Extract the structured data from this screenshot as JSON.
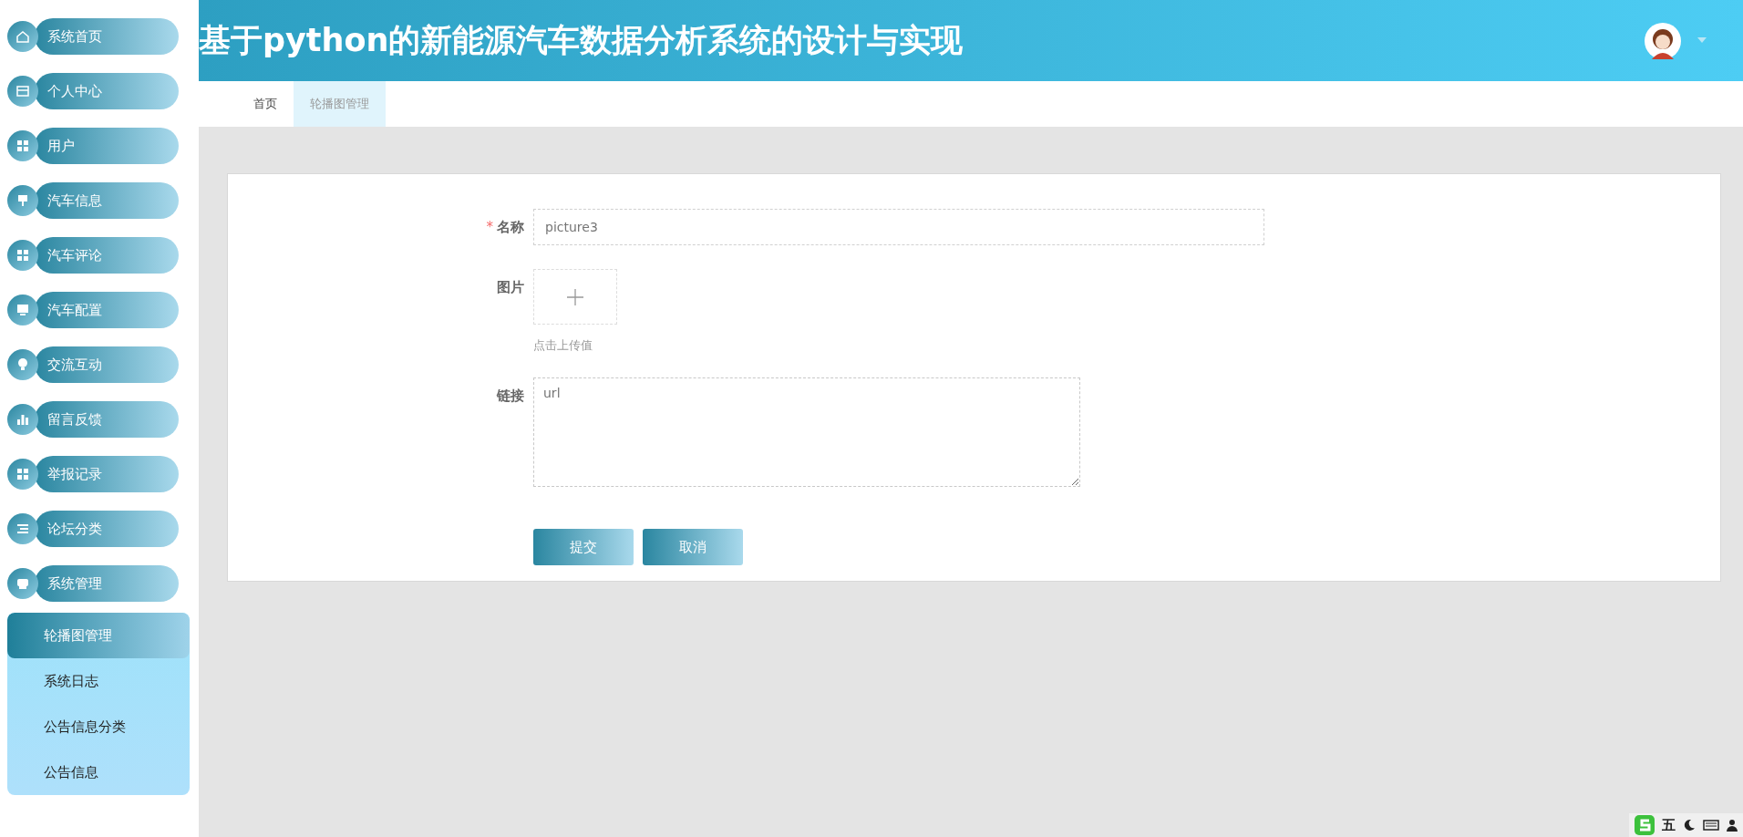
{
  "header": {
    "title": "基于python的新能源汽车数据分析系统的设计与实现"
  },
  "sidebar": {
    "items": [
      {
        "label": "系统首页"
      },
      {
        "label": "个人中心"
      },
      {
        "label": "用户"
      },
      {
        "label": "汽车信息"
      },
      {
        "label": "汽车评论"
      },
      {
        "label": "汽车配置"
      },
      {
        "label": "交流互动"
      },
      {
        "label": "留言反馈"
      },
      {
        "label": "举报记录"
      },
      {
        "label": "论坛分类"
      },
      {
        "label": "系统管理",
        "children": [
          {
            "label": "轮播图管理",
            "selected": true
          },
          {
            "label": "系统日志",
            "selected": false
          },
          {
            "label": "公告信息分类",
            "selected": false
          },
          {
            "label": "公告信息",
            "selected": false
          }
        ]
      }
    ]
  },
  "tabs": [
    {
      "label": "首页",
      "selected": false
    },
    {
      "label": "轮播图管理",
      "selected": true
    }
  ],
  "form": {
    "fields": [
      {
        "kind": "text",
        "label": "名称",
        "required_mark": "*",
        "placeholder": "picture3"
      },
      {
        "kind": "upload",
        "label": "图片",
        "hint": "点击上传值"
      },
      {
        "kind": "textarea",
        "label": "链接",
        "placeholder": "url"
      }
    ],
    "buttons": [
      "提交",
      "取消"
    ]
  },
  "ime_bar": {
    "label": "五"
  }
}
